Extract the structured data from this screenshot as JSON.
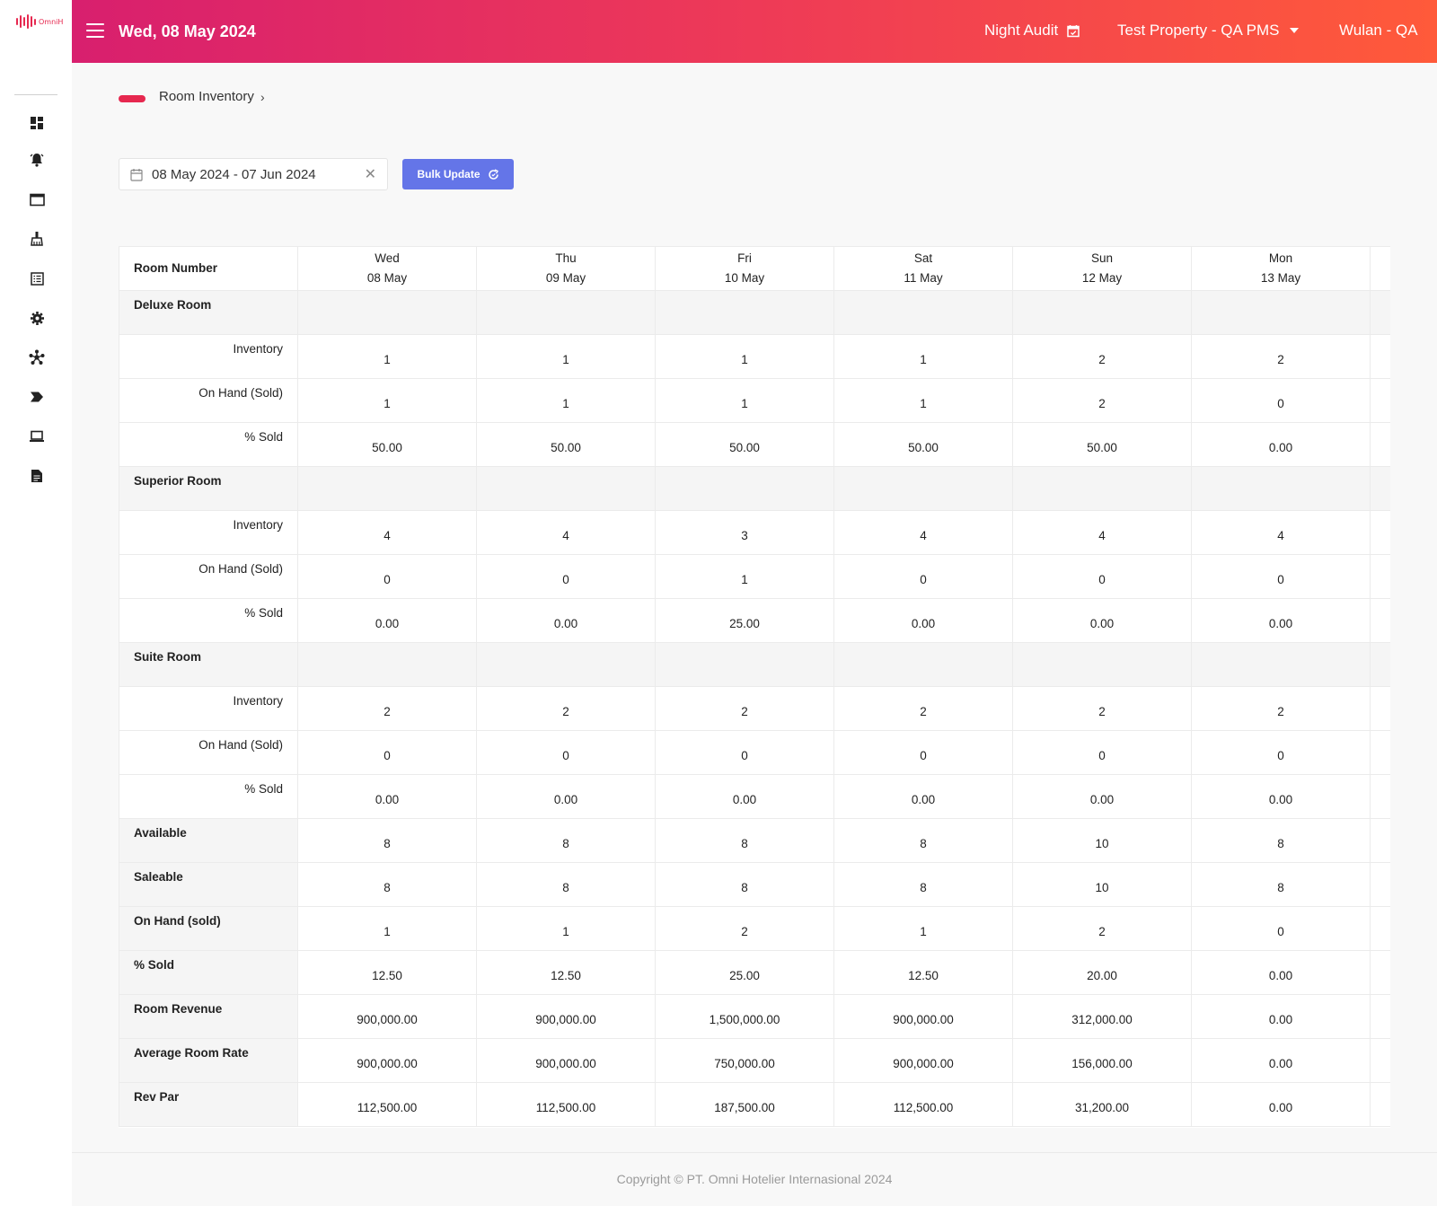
{
  "brand": {
    "name": "OmniH",
    "accent": "#e6284f"
  },
  "sidebar": {
    "items": [
      {
        "icon": "dashboard-icon"
      },
      {
        "icon": "bell-icon"
      },
      {
        "icon": "window-icon"
      },
      {
        "icon": "housekeeping-icon"
      },
      {
        "icon": "list-icon"
      },
      {
        "icon": "gear-icon"
      },
      {
        "icon": "network-icon"
      },
      {
        "icon": "arrow-tag-icon"
      },
      {
        "icon": "laptop-icon"
      },
      {
        "icon": "report-icon"
      }
    ]
  },
  "header": {
    "date": "Wed, 08 May 2024",
    "night_audit": "Night Audit",
    "property": "Test Property - QA PMS",
    "user": "Wulan - QA"
  },
  "breadcrumb": {
    "label": "Room Inventory"
  },
  "filters": {
    "date_range": "08 May 2024 - 07 Jun 2024",
    "bulk_update": "Bulk Update"
  },
  "table": {
    "header_label": "Room Number",
    "days": [
      {
        "dow": "Wed",
        "date": "08 May"
      },
      {
        "dow": "Thu",
        "date": "09 May"
      },
      {
        "dow": "Fri",
        "date": "10 May"
      },
      {
        "dow": "Sat",
        "date": "11 May"
      },
      {
        "dow": "Sun",
        "date": "12 May"
      },
      {
        "dow": "Mon",
        "date": "13 May"
      },
      {
        "dow": "",
        "date": ""
      }
    ],
    "groups": [
      {
        "name": "Deluxe Room",
        "rows": [
          {
            "label": "Inventory",
            "values": [
              "1",
              "1",
              "1",
              "1",
              "2",
              "2",
              ""
            ]
          },
          {
            "label": "On Hand (Sold)",
            "values": [
              "1",
              "1",
              "1",
              "1",
              "2",
              "0",
              ""
            ]
          },
          {
            "label": "% Sold",
            "values": [
              "50.00",
              "50.00",
              "50.00",
              "50.00",
              "50.00",
              "0.00",
              ""
            ]
          }
        ]
      },
      {
        "name": "Superior Room",
        "rows": [
          {
            "label": "Inventory",
            "values": [
              "4",
              "4",
              "3",
              "4",
              "4",
              "4",
              ""
            ]
          },
          {
            "label": "On Hand (Sold)",
            "values": [
              "0",
              "0",
              "1",
              "0",
              "0",
              "0",
              ""
            ]
          },
          {
            "label": "% Sold",
            "values": [
              "0.00",
              "0.00",
              "25.00",
              "0.00",
              "0.00",
              "0.00",
              ""
            ]
          }
        ]
      },
      {
        "name": "Suite Room",
        "rows": [
          {
            "label": "Inventory",
            "values": [
              "2",
              "2",
              "2",
              "2",
              "2",
              "2",
              ""
            ]
          },
          {
            "label": "On Hand (Sold)",
            "values": [
              "0",
              "0",
              "0",
              "0",
              "0",
              "0",
              ""
            ]
          },
          {
            "label": "% Sold",
            "values": [
              "0.00",
              "0.00",
              "0.00",
              "0.00",
              "0.00",
              "0.00",
              ""
            ]
          }
        ]
      }
    ],
    "summary": [
      {
        "label": "Available",
        "values": [
          "8",
          "8",
          "8",
          "8",
          "10",
          "8",
          ""
        ]
      },
      {
        "label": "Saleable",
        "values": [
          "8",
          "8",
          "8",
          "8",
          "10",
          "8",
          ""
        ]
      },
      {
        "label": "On Hand (sold)",
        "values": [
          "1",
          "1",
          "2",
          "1",
          "2",
          "0",
          ""
        ]
      },
      {
        "label": "% Sold",
        "values": [
          "12.50",
          "12.50",
          "25.00",
          "12.50",
          "20.00",
          "0.00",
          ""
        ]
      },
      {
        "label": "Room Revenue",
        "values": [
          "900,000.00",
          "900,000.00",
          "1,500,000.00",
          "900,000.00",
          "312,000.00",
          "0.00",
          ""
        ]
      },
      {
        "label": "Average Room Rate",
        "values": [
          "900,000.00",
          "900,000.00",
          "750,000.00",
          "900,000.00",
          "156,000.00",
          "0.00",
          ""
        ]
      },
      {
        "label": "Rev Par",
        "values": [
          "112,500.00",
          "112,500.00",
          "187,500.00",
          "112,500.00",
          "31,200.00",
          "0.00",
          ""
        ]
      }
    ]
  },
  "footer": {
    "copyright": "Copyright © PT. Omni Hotelier Internasional 2024"
  }
}
